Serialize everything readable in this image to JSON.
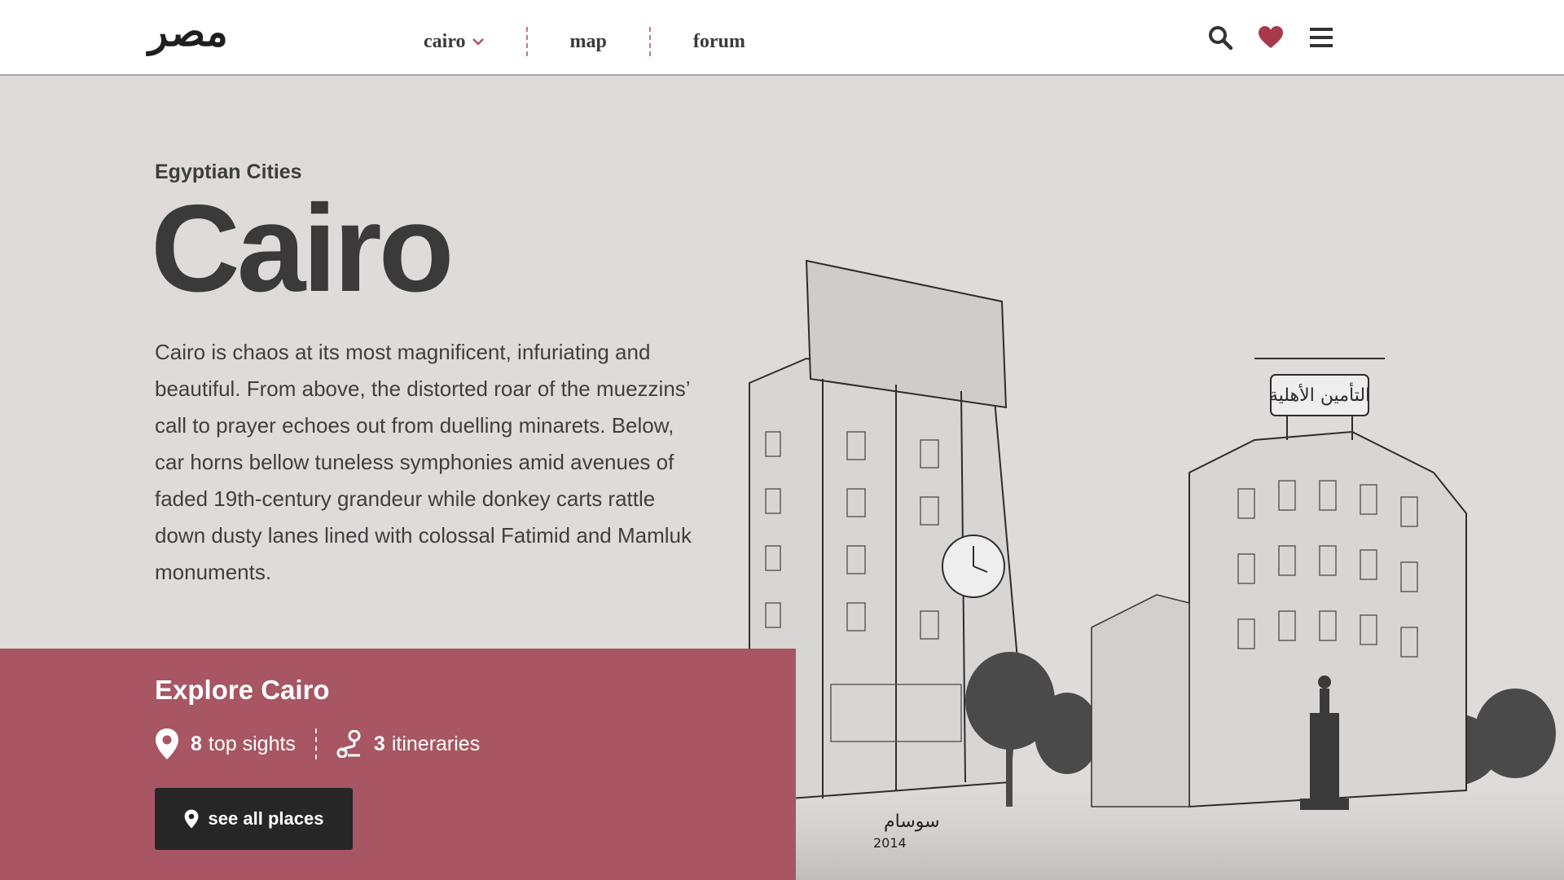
{
  "header": {
    "logo": "مصر",
    "nav": [
      {
        "label": "cairo",
        "has_dropdown": true
      },
      {
        "label": "map"
      },
      {
        "label": "forum"
      }
    ],
    "icons": [
      "search-icon",
      "heart-icon",
      "menu-icon"
    ]
  },
  "hero": {
    "eyebrow": "Egyptian Cities",
    "title": "Cairo",
    "intro": "Cairo is chaos at its most magnificent, infuriating and beautiful. From above, the distorted roar of the muezzins’ call to prayer echoes out from duelling minarets. Below, car horns bellow tuneless symphonies amid avenues of faded 19th-century grandeur while donkey carts rattle down dusty lanes lined with colossal Fatimid and Mamluk monuments."
  },
  "illustration": {
    "sign_text": "التأمين الأهلية",
    "signature": "سوسام",
    "signature_year": "2014"
  },
  "explore": {
    "title": "Explore Cairo",
    "sights_count": "8",
    "sights_label": "top sights",
    "itineraries_count": "3",
    "itineraries_label": "itineraries",
    "button_label": "see all places"
  },
  "colors": {
    "accent": "#a85663",
    "background": "#dfdbdb",
    "text": "#3a3a3a",
    "button": "#262626"
  }
}
